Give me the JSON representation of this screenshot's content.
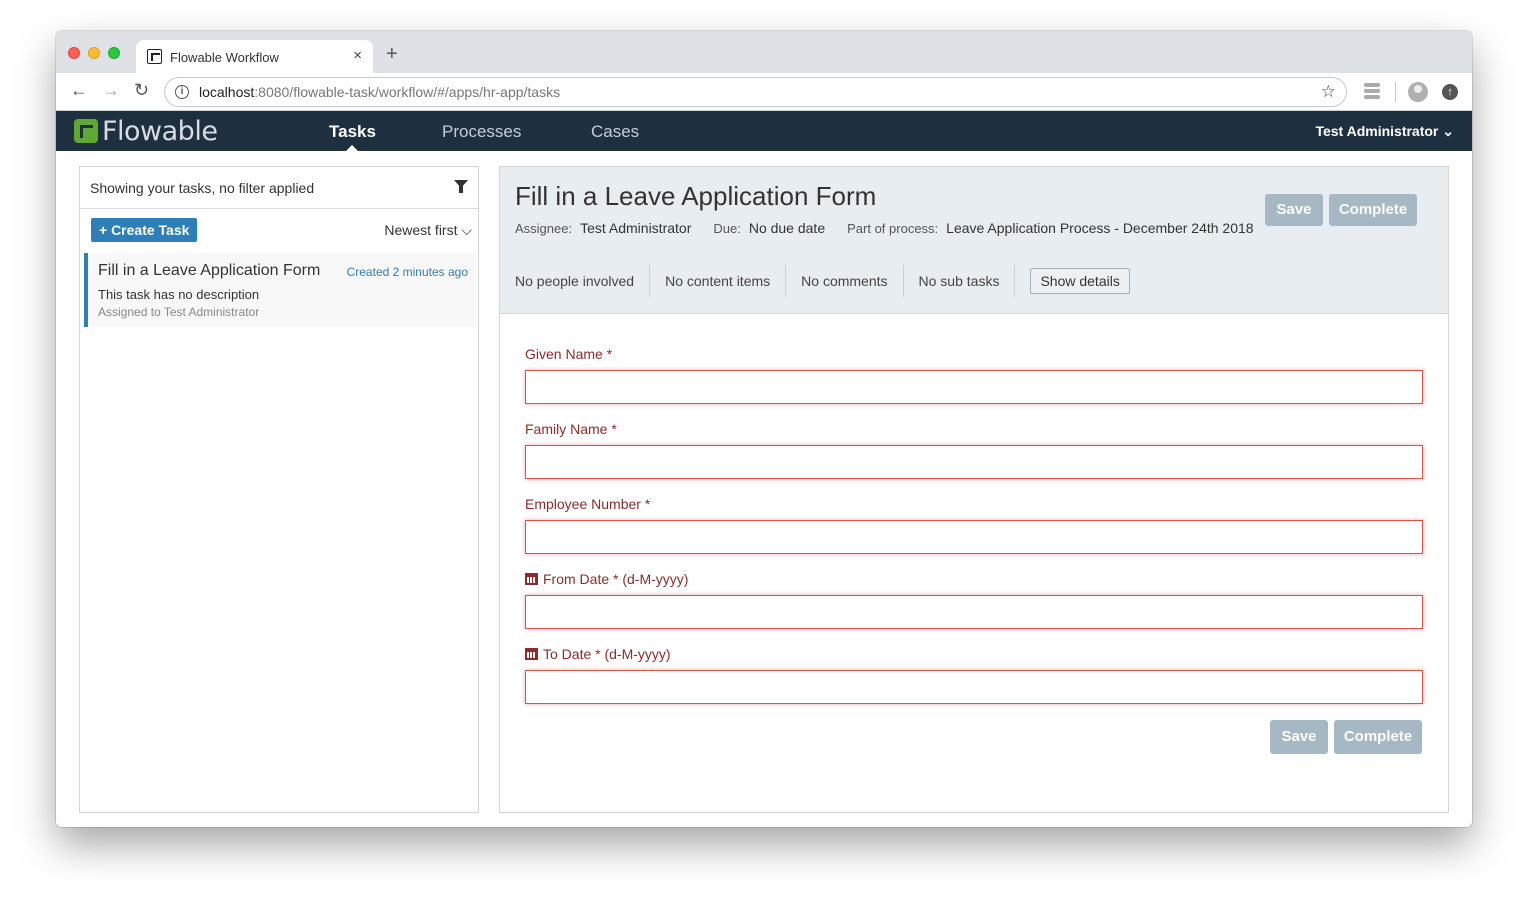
{
  "browser": {
    "tab_title": "Flowable Workflow",
    "tab_close": "×",
    "new_tab": "+",
    "url_host": "localhost",
    "url_rest": ":8080/flowable-task/workflow/#/apps/hr-app/tasks",
    "back": "←",
    "forward": "→",
    "reload": "↻",
    "star": "☆"
  },
  "app": {
    "logo_text": "Flowable",
    "nav": {
      "tasks": "Tasks",
      "processes": "Processes",
      "cases": "Cases"
    },
    "user_menu": "Test Administrator ⌄"
  },
  "tasklist": {
    "filter_text": "Showing your tasks, no filter applied",
    "create_task": "+ Create Task",
    "sort": "Newest first ⌵",
    "items": [
      {
        "title": "Fill in a Leave Application Form",
        "created": "Created 2 minutes ago",
        "description": "This task has no description",
        "assigned": "Assigned to Test Administrator"
      }
    ]
  },
  "task": {
    "title": "Fill in a Leave Application Form",
    "assignee_label": "Assignee:",
    "assignee": "Test Administrator",
    "due_label": "Due:",
    "due": "No due date",
    "process_label": "Part of process:",
    "process": "Leave Application Process - December 24th 2018",
    "save": "Save",
    "complete": "Complete",
    "stats": {
      "people": "No people involved",
      "content": "No content items",
      "comments": "No comments",
      "subtasks": "No sub tasks"
    },
    "show_details": "Show details"
  },
  "form": {
    "fields": [
      {
        "label": "Given Name *",
        "value": ""
      },
      {
        "label": "Family Name *",
        "value": ""
      },
      {
        "label": "Employee Number *",
        "value": ""
      },
      {
        "label": "From Date * (d-M-yyyy)",
        "value": ""
      },
      {
        "label": "To Date * (d-M-yyyy)",
        "value": ""
      }
    ],
    "save": "Save",
    "complete": "Complete"
  },
  "colors": {
    "nav_bg": "#1e2f40",
    "primary": "#2e7fb8",
    "disabled_button": "#a5b8c3",
    "required_label": "#8b2c2c",
    "invalid_border": "#d9534f",
    "logo_green": "#5ea934"
  }
}
